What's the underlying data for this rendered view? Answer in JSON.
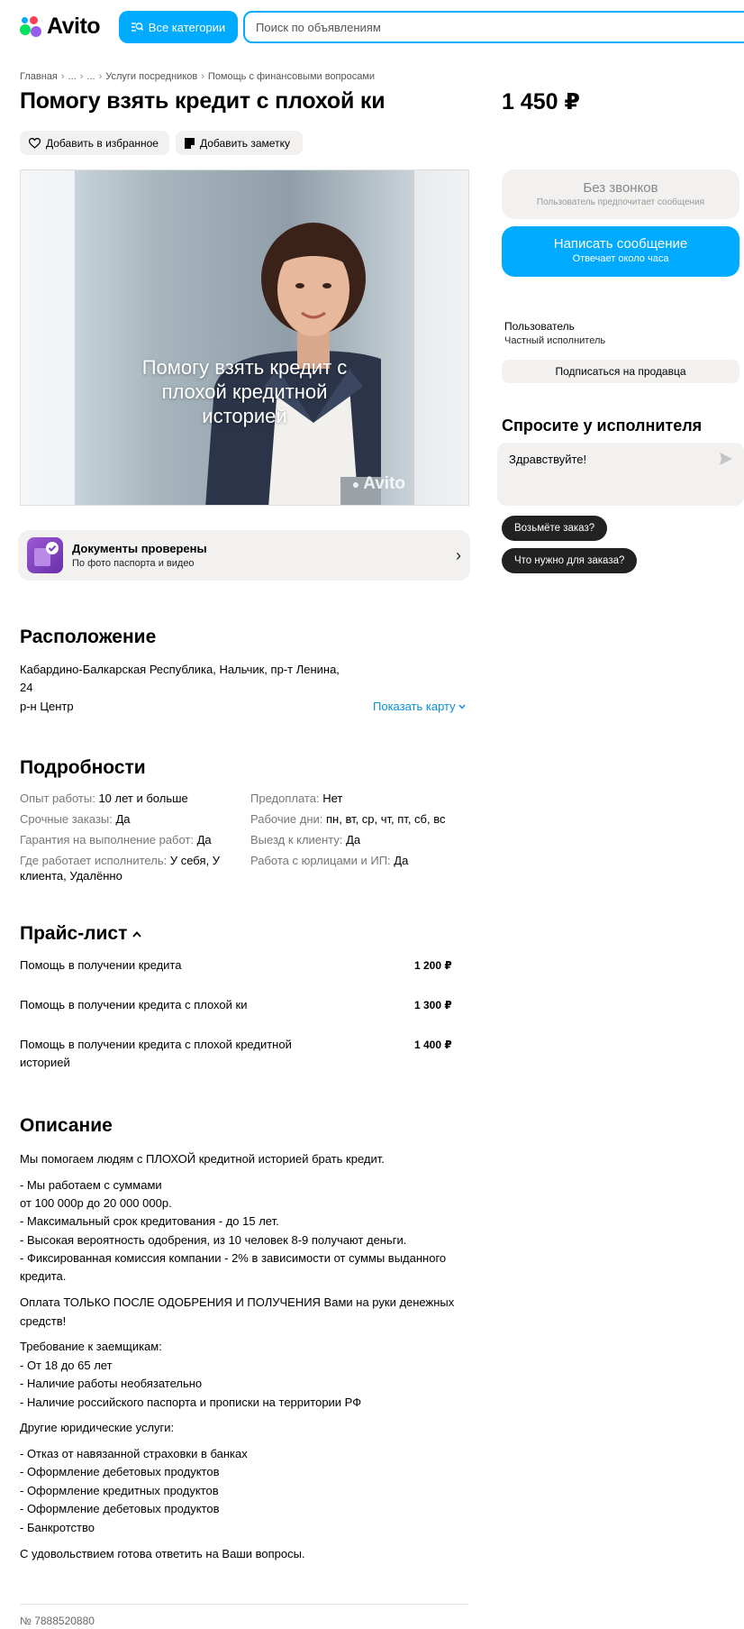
{
  "header": {
    "logo_text": "Avito",
    "categories_label": "Все категории",
    "search_placeholder": "Поиск по объявлениям"
  },
  "breadcrumb": [
    "Главная",
    "...",
    "...",
    "Услуги посредников",
    "Помощь с финансовыми вопросами"
  ],
  "listing": {
    "title": "Помогу взять кредит с плохой ки",
    "price": "1 450 ₽",
    "favorite_label": "Добавить в избранное",
    "note_label": "Добавить заметку",
    "photo_caption_1": "Помогу взять кредит с",
    "photo_caption_2": "плохой кредитной",
    "photo_caption_3": "историей",
    "photo_watermark": "Avito"
  },
  "docs": {
    "title": "Документы проверены",
    "subtitle": "По фото паспорта и видео"
  },
  "sidebar": {
    "no_calls_title": "Без звонков",
    "no_calls_sub": "Пользователь предпочитает сообщения",
    "write_title": "Написать сообщение",
    "write_sub": "Отвечает около часа",
    "seller_name": "Пользователь",
    "seller_type": "Частный исполнитель",
    "subscribe_label": "Подписаться на продавца",
    "ask_title": "Спросите у исполнителя",
    "ask_text": "Здравствуйте!",
    "chips": [
      "Возьмёте заказ?",
      "Что нужно для заказа?"
    ]
  },
  "location": {
    "heading": "Расположение",
    "line1": "Кабардино-Балкарская Республика, Нальчик, пр-т Ленина,",
    "line2": "24",
    "district": "р-н Центр",
    "map_link": "Показать карту"
  },
  "details": {
    "heading": "Подробности",
    "items": [
      {
        "label": "Опыт работы:",
        "value": "10 лет и больше"
      },
      {
        "label": "Срочные заказы:",
        "value": "Да"
      },
      {
        "label": "Гарантия на выполнение работ:",
        "value": "Да"
      },
      {
        "label": "Где работает исполнитель:",
        "value": "У себя, У"
      },
      {
        "label": "Предоплата:",
        "value": "Нет"
      },
      {
        "label": "Рабочие дни:",
        "value": "пн, вт, ср, чт, пт, сб, вс"
      },
      {
        "label": "Выезд к клиенту:",
        "value": "Да"
      },
      {
        "label": "Работа с юрлицами и ИП:",
        "value": "Да"
      }
    ],
    "where_cont": "клиента, Удалённо"
  },
  "pricelist": {
    "heading": "Прайс-лист",
    "items": [
      {
        "name": "Помощь в получении кредита",
        "price": "1 200 ₽"
      },
      {
        "name": "Помощь в получении кредита с плохой ки",
        "price": "1 300 ₽"
      },
      {
        "name": "Помощь в получении кредита с плохой кредитной",
        "price": "1 400 ₽"
      }
    ],
    "item3_cont": "историей"
  },
  "description": {
    "heading": "Описание",
    "lines": [
      "Мы помогаем людям с ПЛОХОЙ кредитной историей брать кредит.",
      "- Мы работаем с суммами",
      "от 100 000р до 20 000 000р.",
      "- Максимальный срок кредитования - до 15 лет.",
      "- Высокая вероятность одобрения, из 10 человек 8-9 получают деньги.",
      "- Фиксированная комиссия компании - 2% в зависимости от суммы выданного",
      "кредита.",
      "Оплата ТОЛЬКО ПОСЛЕ ОДОБРЕНИЯ И ПОЛУЧЕНИЯ Вами на руки денежных",
      "средств!",
      "Требование к заемщикам:",
      "- От 18 до 65 лет",
      "- Наличие работы необязательно",
      "- Наличие российского паспорта и прописки на территории РФ",
      "Другие юридические услуги:",
      "- Отказ от навязанной страховки в банках",
      "- Оформление дебетовых продуктов",
      "- Оформление кредитных продуктов",
      "- Оформление дебетовых продуктов",
      "- Банкротство",
      "С удовольствием готова ответить на Ваши вопросы."
    ]
  },
  "footer": {
    "item_number": "№ 7888520880"
  },
  "colors": {
    "accent": "#00aaff",
    "chip": "#222222",
    "pill": "#f2f1f0",
    "link": "#0a8fd8"
  }
}
